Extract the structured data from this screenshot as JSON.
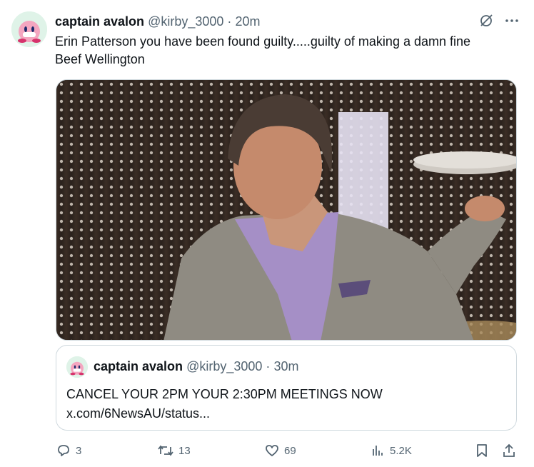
{
  "tweet": {
    "display_name": "captain avalon",
    "handle": "@kirby_3000",
    "separator": "·",
    "time": "20m",
    "text_line1": "Erin Patterson you have been found guilty.....guilty of making a damn fine",
    "text_line2": "Beef Wellington"
  },
  "quote": {
    "display_name": "captain avalon",
    "handle": "@kirby_3000",
    "separator": "·",
    "time": "30m",
    "text_line1": "CANCEL YOUR 2PM YOUR 2:30PM MEETINGS NOW",
    "text_line2": "x.com/6NewsAU/status..."
  },
  "actions": {
    "replies": "3",
    "reposts": "13",
    "likes": "69",
    "views": "5.2K"
  },
  "icons": {
    "grok": "grok-slash-icon",
    "more": "more-dots-icon",
    "reply": "reply-icon",
    "repost": "repost-icon",
    "like": "heart-icon",
    "views": "views-bar-icon",
    "bookmark": "bookmark-icon",
    "share": "share-icon"
  },
  "colors": {
    "text_primary": "#0f1419",
    "text_secondary": "#536471",
    "border": "#cfd9de",
    "avatar_bg": "#dff3e8",
    "kirby_pink": "#f4a6c0"
  }
}
